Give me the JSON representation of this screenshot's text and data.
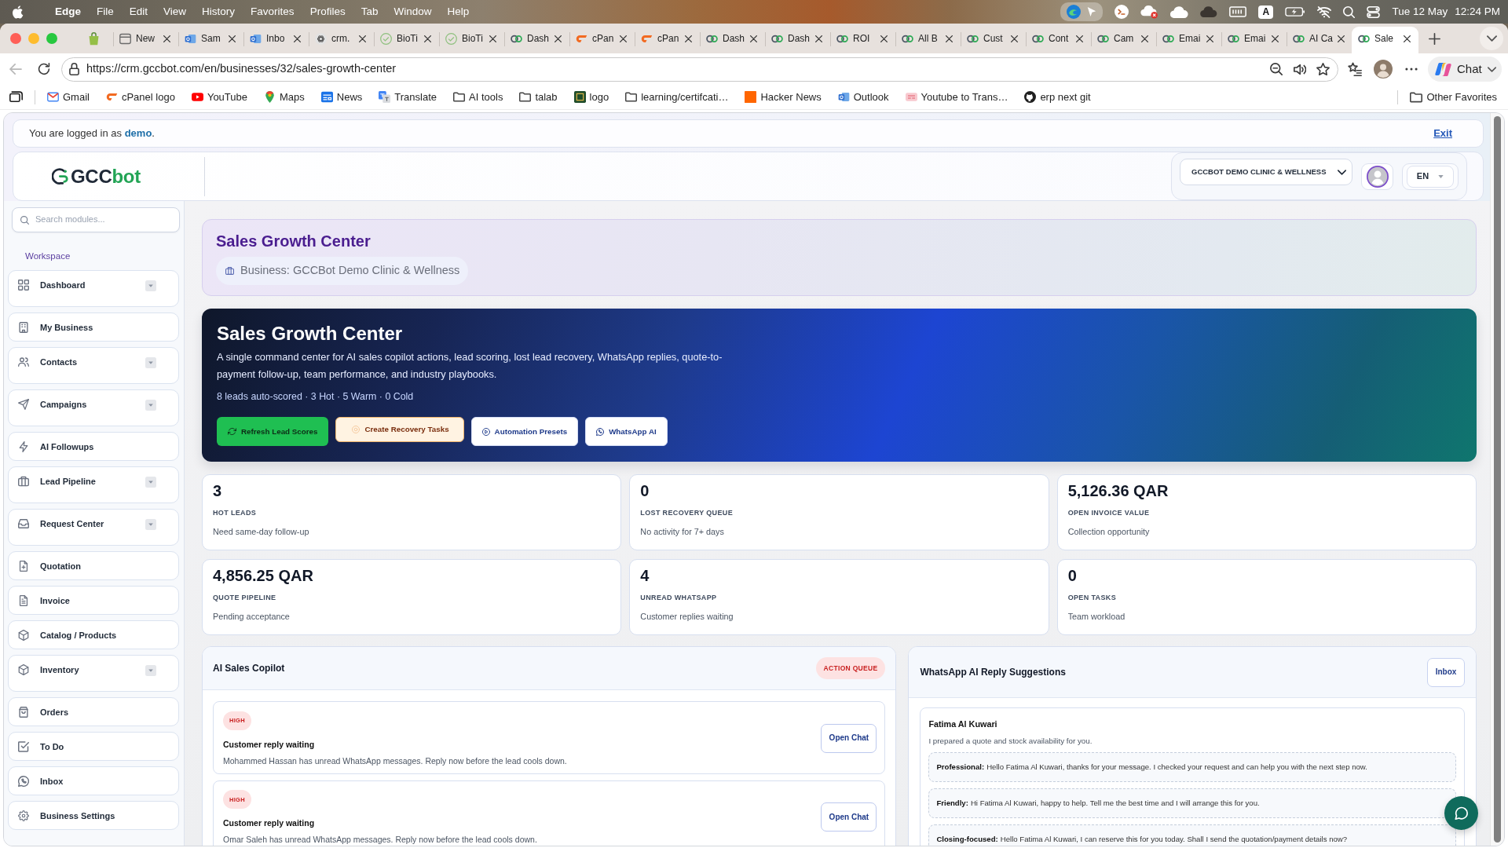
{
  "menu_bar": {
    "app": "Edge",
    "menus": [
      "File",
      "Edit",
      "View",
      "History",
      "Favorites",
      "Profiles",
      "Tab",
      "Window",
      "Help"
    ],
    "input_source": "A",
    "date": "Tue 12 May",
    "time": "12:24 PM"
  },
  "tabs": [
    {
      "label": "New",
      "kind": "page",
      "selected": false
    },
    {
      "label": "Sam",
      "kind": "mail",
      "selected": false
    },
    {
      "label": "Inbo",
      "kind": "mail",
      "selected": false
    },
    {
      "label": "crm.",
      "kind": "knot",
      "selected": false
    },
    {
      "label": "BioTi",
      "kind": "check",
      "selected": false
    },
    {
      "label": "BioTi",
      "kind": "check",
      "selected": false
    },
    {
      "label": "Dash",
      "kind": "site",
      "selected": false
    },
    {
      "label": "cPan",
      "kind": "swoosh",
      "selected": false
    },
    {
      "label": "cPan",
      "kind": "swoosh",
      "selected": false
    },
    {
      "label": "Dash",
      "kind": "site",
      "selected": false
    },
    {
      "label": "Dash",
      "kind": "site",
      "selected": false
    },
    {
      "label": "ROI",
      "kind": "site",
      "selected": false
    },
    {
      "label": "All B",
      "kind": "site",
      "selected": false
    },
    {
      "label": "Cust",
      "kind": "site",
      "selected": false
    },
    {
      "label": "Cont",
      "kind": "site",
      "selected": false
    },
    {
      "label": "Cam",
      "kind": "site",
      "selected": false
    },
    {
      "label": "Emai",
      "kind": "site",
      "selected": false
    },
    {
      "label": "Emai",
      "kind": "site",
      "selected": false
    },
    {
      "label": "AI Ca",
      "kind": "site",
      "selected": false
    },
    {
      "label": "Sale",
      "kind": "site",
      "selected": true
    }
  ],
  "address_bar": {
    "url": "https://crm.gccbot.com/en/businesses/32/sales-growth-center"
  },
  "chat_button": {
    "label": "Chat"
  },
  "bookmarks": [
    {
      "label": "Gmail",
      "kind": "gmail"
    },
    {
      "label": "cPanel logo",
      "kind": "swoosh"
    },
    {
      "label": "YouTube",
      "kind": "video"
    },
    {
      "label": "Maps",
      "kind": "pin"
    },
    {
      "label": "News",
      "kind": "news"
    },
    {
      "label": "Translate",
      "kind": "translate"
    },
    {
      "label": "AI tools",
      "kind": "folder"
    },
    {
      "label": "talab",
      "kind": "folder"
    },
    {
      "label": "logo",
      "kind": "emblem"
    },
    {
      "label": "learning/certifcati…",
      "kind": "folder"
    },
    {
      "label": "Hacker News",
      "kind": "square"
    },
    {
      "label": "Outlook",
      "kind": "mail"
    },
    {
      "label": "Youtube to Trans…",
      "kind": "caption"
    },
    {
      "label": "erp next git",
      "kind": "octo"
    }
  ],
  "other_favorites": "Other Favorites",
  "session_bar": {
    "lead": "You are logged in as ",
    "user": "demo",
    "trail": ".",
    "exit": "Exit"
  },
  "header": {
    "logo": "GCC",
    "logo_accent": "bot",
    "business_select": "GCCBOT DEMO CLINIC & WELLNESS",
    "language": "EN"
  },
  "sidebar": {
    "search_placeholder": "Search modules...",
    "section": "Workspace",
    "items": [
      {
        "label": "Dashboard",
        "kind": "grid",
        "expandable": true
      },
      {
        "label": "My Business",
        "kind": "building",
        "expandable": false
      },
      {
        "label": "Contacts",
        "kind": "users",
        "expandable": true
      },
      {
        "label": "Campaigns",
        "kind": "send",
        "expandable": true
      },
      {
        "label": "AI Followups",
        "kind": "bolt",
        "expandable": false
      },
      {
        "label": "Lead Pipeline",
        "kind": "briefcase",
        "expandable": true
      },
      {
        "label": "Request Center",
        "kind": "inbox",
        "expandable": true
      },
      {
        "label": "Quotation",
        "kind": "file-plus",
        "expandable": false
      },
      {
        "label": "Invoice",
        "kind": "file",
        "expandable": false
      },
      {
        "label": "Catalog / Products",
        "kind": "box",
        "expandable": false
      },
      {
        "label": "Inventory",
        "kind": "box",
        "expandable": true
      },
      {
        "label": "Orders",
        "kind": "bag",
        "expandable": false
      },
      {
        "label": "To Do",
        "kind": "check",
        "expandable": false
      },
      {
        "label": "Inbox",
        "kind": "whatsapp",
        "expandable": false
      },
      {
        "label": "Business Settings",
        "kind": "gear",
        "expandable": false
      }
    ]
  },
  "page_header": {
    "title": "Sales Growth Center",
    "business": "Business: GCCBot Demo Clinic & Wellness"
  },
  "hero": {
    "title": "Sales Growth Center",
    "description": "A single command center for AI sales copilot actions, lead scoring, lost lead recovery, WhatsApp replies, quote-to-payment follow-up, team performance, and industry playbooks.",
    "summary": "8 leads auto-scored · 3 Hot · 5 Warm · 0 Cold",
    "buttons": [
      {
        "label": "Refresh Lead Scores",
        "kind": "refresh"
      },
      {
        "label": "Create Recovery Tasks",
        "kind": "recovery"
      },
      {
        "label": "Automation Presets",
        "kind": "presets"
      },
      {
        "label": "WhatsApp AI",
        "kind": "whatsapp"
      }
    ]
  },
  "stats": [
    {
      "value": "3",
      "label": "HOT LEADS",
      "note": "Need same-day follow-up"
    },
    {
      "value": "0",
      "label": "LOST RECOVERY QUEUE",
      "note": "No activity for 7+ days"
    },
    {
      "value": "5,126.36 QAR",
      "label": "OPEN INVOICE VALUE",
      "note": "Collection opportunity"
    },
    {
      "value": "4,856.25 QAR",
      "label": "QUOTE PIPELINE",
      "note": "Pending acceptance"
    },
    {
      "value": "4",
      "label": "UNREAD WHATSAPP",
      "note": "Customer replies waiting"
    },
    {
      "value": "0",
      "label": "OPEN TASKS",
      "note": "Team workload"
    }
  ],
  "copilot": {
    "title": "AI Sales Copilot",
    "badge": "ACTION QUEUE",
    "items": [
      {
        "priority": "HIGH",
        "title": "Customer reply waiting",
        "detail": "Mohammed Hassan has unread WhatsApp messages. Reply now before the lead cools down.",
        "action": "Open Chat"
      },
      {
        "priority": "HIGH",
        "title": "Customer reply waiting",
        "detail": "Omar Saleh has unread WhatsApp messages. Reply now before the lead cools down.",
        "action": "Open Chat"
      }
    ]
  },
  "reply_suggestions": {
    "title": "WhatsApp AI Reply Suggestions",
    "action": "Inbox",
    "contact": "Fatima Al Kuwari",
    "message": "I prepared a quote and stock availability for you.",
    "suggestions": [
      "**Professional:** Hello Fatima Al Kuwari, thanks for your message. I checked your request and can help you with the next step now.",
      "**Friendly:** Hi Fatima Al Kuwari, happy to help. Tell me the best time and I will arrange this for you.",
      "**Closing-focused:** Hello Fatima Al Kuwari, I can reserve this for you today. Shall I send the quotation/payment details now?"
    ]
  }
}
